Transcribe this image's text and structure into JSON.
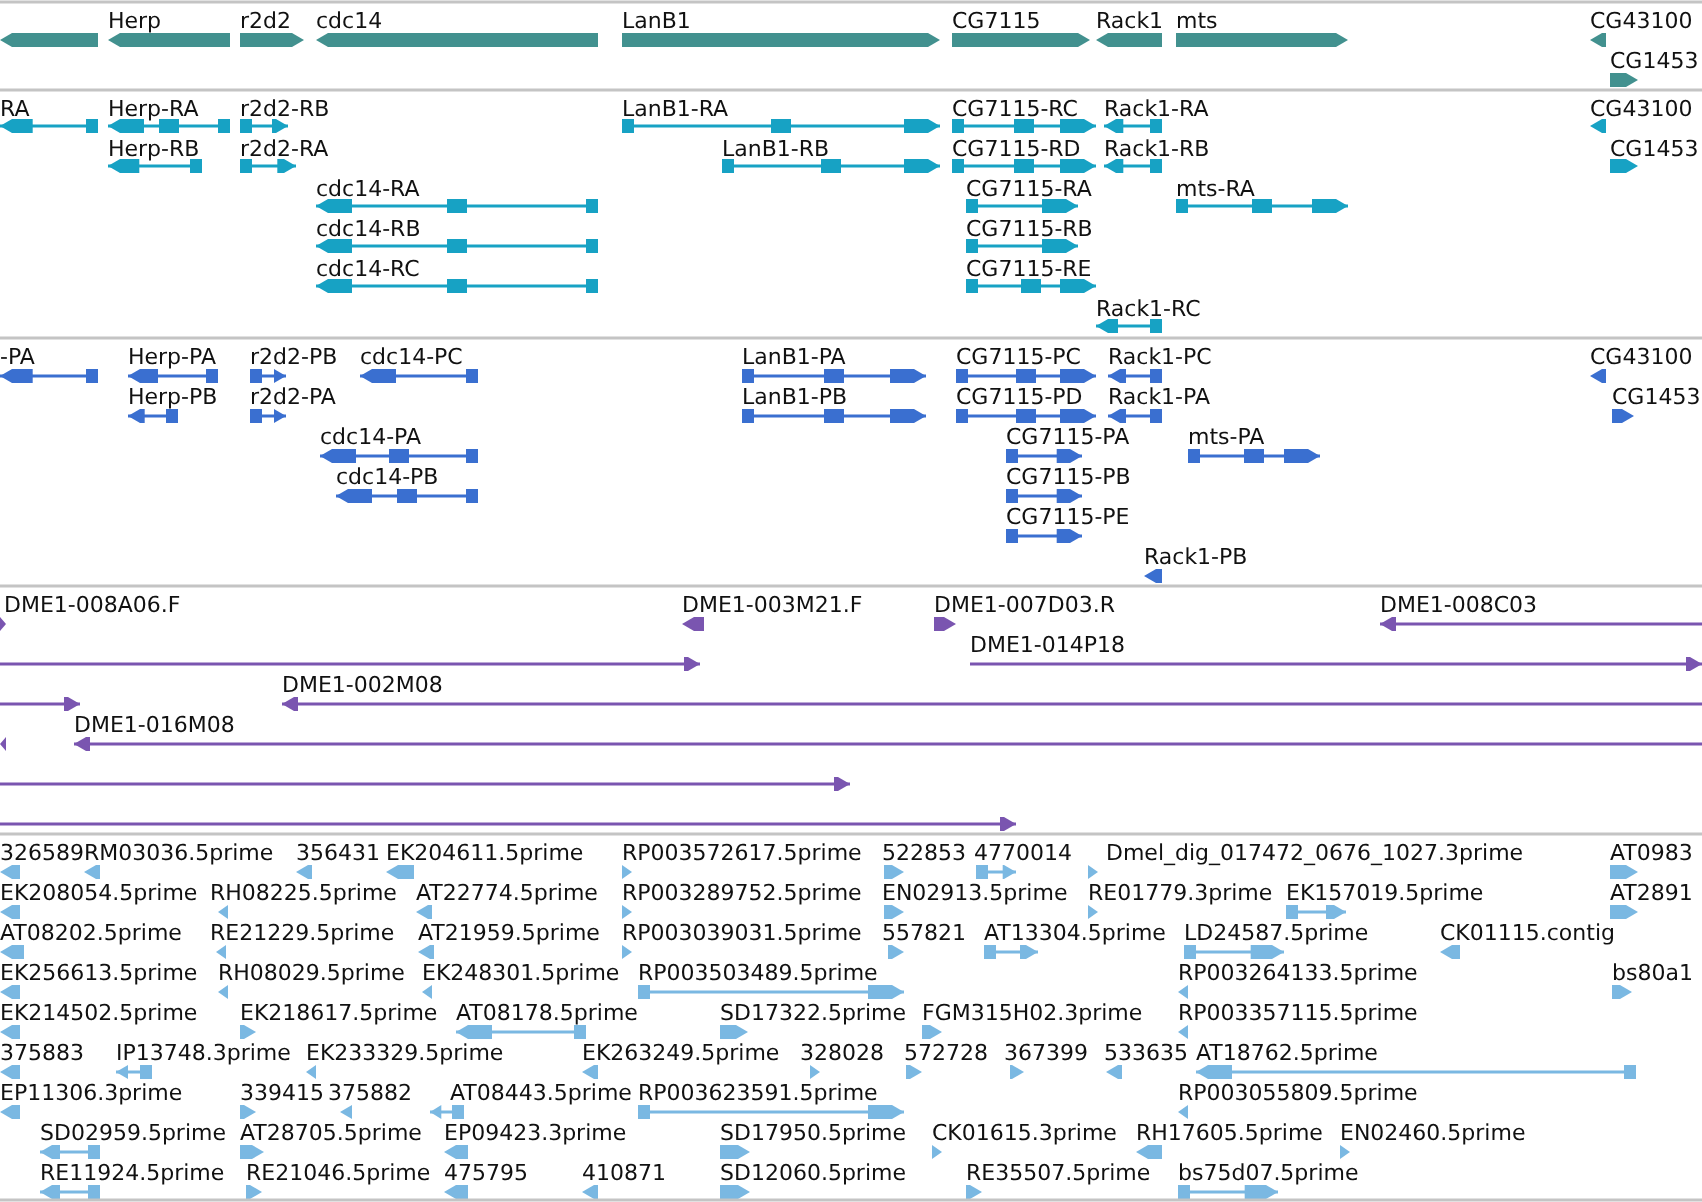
{
  "tracks": [
    {
      "kind": "gene",
      "color": "#42918f",
      "features": [
        {
          "reverse": true
        },
        {
          "label": "Herp",
          "reverse": true
        },
        {
          "label": "r2d2",
          "reverse": false
        },
        {
          "label": "cdc14",
          "reverse": true
        },
        {
          "label": "LanB1",
          "reverse": false
        },
        {
          "label": "CG7115",
          "reverse": false
        },
        {
          "label": "Rack1",
          "reverse": true
        },
        {
          "label": "mts",
          "reverse": false
        },
        {
          "label": "CG43100",
          "reverse": true
        },
        {
          "label": "CG1453",
          "reverse": false
        }
      ]
    },
    {
      "kind": "transcript",
      "color": "#17a2c4",
      "features": [
        {
          "label": "RA",
          "reverse": true
        },
        {
          "label": "Herp-RA",
          "reverse": true
        },
        {
          "label": "r2d2-RB",
          "reverse": false
        },
        {
          "label": "LanB1-RA",
          "reverse": false
        },
        {
          "label": "CG7115-RC",
          "reverse": false
        },
        {
          "label": "Rack1-RA",
          "reverse": true
        },
        {
          "label": "CG43100",
          "reverse": true
        },
        {
          "label": "Herp-RB",
          "reverse": true
        },
        {
          "label": "r2d2-RA",
          "reverse": false
        },
        {
          "label": "LanB1-RB",
          "reverse": false
        },
        {
          "label": "CG7115-RD",
          "reverse": false
        },
        {
          "label": "Rack1-RB",
          "reverse": true
        },
        {
          "label": "CG1453",
          "reverse": false
        },
        {
          "label": "cdc14-RA",
          "reverse": true
        },
        {
          "label": "CG7115-RA",
          "reverse": false
        },
        {
          "label": "mts-RA",
          "reverse": false
        },
        {
          "label": "cdc14-RB",
          "reverse": true
        },
        {
          "label": "CG7115-RB",
          "reverse": false
        },
        {
          "label": "cdc14-RC",
          "reverse": true
        },
        {
          "label": "CG7115-RE",
          "reverse": false
        },
        {
          "label": "Rack1-RC",
          "reverse": true
        }
      ]
    },
    {
      "kind": "protein",
      "color": "#3a6fd0",
      "features": [
        {
          "label": "-PA",
          "reverse": true
        },
        {
          "label": "Herp-PA",
          "reverse": true
        },
        {
          "label": "r2d2-PB",
          "reverse": false
        },
        {
          "label": "cdc14-PC",
          "reverse": true
        },
        {
          "label": "LanB1-PA",
          "reverse": false
        },
        {
          "label": "CG7115-PC",
          "reverse": false
        },
        {
          "label": "Rack1-PC",
          "reverse": true
        },
        {
          "label": "CG43100",
          "reverse": true
        },
        {
          "label": "Herp-PB",
          "reverse": true
        },
        {
          "label": "r2d2-PA",
          "reverse": false
        },
        {
          "label": "LanB1-PB",
          "reverse": false
        },
        {
          "label": "CG7115-PD",
          "reverse": false
        },
        {
          "label": "Rack1-PA",
          "reverse": true
        },
        {
          "label": "CG1453",
          "reverse": false
        },
        {
          "label": "cdc14-PA",
          "reverse": true
        },
        {
          "label": "CG7115-PA",
          "reverse": false
        },
        {
          "label": "mts-PA",
          "reverse": false
        },
        {
          "label": "cdc14-PB",
          "reverse": true
        },
        {
          "label": "CG7115-PB",
          "reverse": false
        },
        {
          "label": "CG7115-PE",
          "reverse": false
        },
        {
          "label": "Rack1-PB",
          "reverse": true
        }
      ]
    },
    {
      "kind": "clone",
      "color": "#7a55b0",
      "features": [
        {
          "label": "DME1-008A06.F",
          "reverse": false
        },
        {
          "label": "DME1-003M21.F",
          "reverse": true
        },
        {
          "label": "DME1-007D03.R",
          "reverse": false
        },
        {
          "label": "DME1-008C03",
          "reverse": true
        },
        {
          "reverse": false
        },
        {
          "label": "DME1-014P18",
          "reverse": false
        },
        {
          "reverse": false
        },
        {
          "label": "DME1-002M08",
          "reverse": true
        },
        {
          "reverse": true
        },
        {
          "label": "DME1-016M08",
          "reverse": true
        },
        {
          "reverse": false
        },
        {
          "reverse": false
        }
      ]
    },
    {
      "kind": "est",
      "color": "#7ab8e2",
      "features": [
        {
          "label": "326589",
          "reverse": true
        },
        {
          "label": "RM03036.5prime",
          "reverse": true
        },
        {
          "label": "356431",
          "reverse": true
        },
        {
          "label": "EK204611.5prime",
          "reverse": true
        },
        {
          "label": "RP003572617.5prime",
          "reverse": false
        },
        {
          "label": "522853",
          "reverse": false
        },
        {
          "label": "4770014",
          "reverse": false
        },
        {
          "label": "Dmel_dig_017472_0676_1027.3prime",
          "reverse": false
        },
        {
          "label": "AT0983",
          "reverse": false
        },
        {
          "label": "EK208054.5prime",
          "reverse": true
        },
        {
          "label": "RH08225.5prime",
          "reverse": true
        },
        {
          "label": "AT22774.5prime",
          "reverse": true
        },
        {
          "label": "RP003289752.5prime",
          "reverse": false
        },
        {
          "label": "EN02913.5prime",
          "reverse": false
        },
        {
          "label": "RE01779.3prime",
          "reverse": false
        },
        {
          "label": "EK157019.5prime",
          "reverse": false
        },
        {
          "label": "AT2891",
          "reverse": false
        },
        {
          "label": "AT08202.5prime",
          "reverse": true
        },
        {
          "label": "RE21229.5prime",
          "reverse": true
        },
        {
          "label": "AT21959.5prime",
          "reverse": true
        },
        {
          "label": "RP003039031.5prime",
          "reverse": false
        },
        {
          "label": "557821",
          "reverse": false
        },
        {
          "label": "AT13304.5prime",
          "reverse": false
        },
        {
          "label": "LD24587.5prime",
          "reverse": false
        },
        {
          "label": "CK01115.contig",
          "reverse": true
        },
        {
          "label": "EK256613.5prime",
          "reverse": true
        },
        {
          "label": "RH08029.5prime",
          "reverse": true
        },
        {
          "label": "EK248301.5prime",
          "reverse": true
        },
        {
          "label": "RP003503489.5prime",
          "reverse": false
        },
        {
          "label": "RP003264133.5prime",
          "reverse": true
        },
        {
          "label": "bs80a1",
          "reverse": false
        },
        {
          "label": "EK214502.5prime",
          "reverse": true
        },
        {
          "label": "EK218617.5prime",
          "reverse": false
        },
        {
          "label": "AT08178.5prime",
          "reverse": true
        },
        {
          "label": "SD17322.5prime",
          "reverse": false
        },
        {
          "label": "FGM315H02.3prime",
          "reverse": false
        },
        {
          "label": "RP003357115.5prime",
          "reverse": true
        },
        {
          "label": "375883",
          "reverse": true
        },
        {
          "label": "IP13748.3prime",
          "reverse": true
        },
        {
          "label": "EK233329.5prime",
          "reverse": true
        },
        {
          "label": "EK263249.5prime",
          "reverse": true
        },
        {
          "label": "328028",
          "reverse": false
        },
        {
          "label": "572728",
          "reverse": false
        },
        {
          "label": "367399",
          "reverse": false
        },
        {
          "label": "533635",
          "reverse": true
        },
        {
          "label": "AT18762.5prime",
          "reverse": true
        },
        {
          "label": "EP11306.3prime",
          "reverse": true
        },
        {
          "label": "339415",
          "reverse": false
        },
        {
          "label": "375882",
          "reverse": true
        },
        {
          "label": "AT08443.5prime",
          "reverse": true
        },
        {
          "label": "RP003623591.5prime",
          "reverse": false
        },
        {
          "label": "RP003055809.5prime",
          "reverse": true
        },
        {
          "label": "SD02959.5prime",
          "reverse": true
        },
        {
          "label": "AT28705.5prime",
          "reverse": false
        },
        {
          "label": "EP09423.3prime",
          "reverse": true
        },
        {
          "label": "SD17950.5prime",
          "reverse": false
        },
        {
          "label": "CK01615.3prime",
          "reverse": false
        },
        {
          "label": "RH17605.5prime",
          "reverse": true
        },
        {
          "label": "EN02460.5prime",
          "reverse": false
        },
        {
          "label": "RE11924.5prime",
          "reverse": true
        },
        {
          "label": "RE21046.5prime",
          "reverse": false
        },
        {
          "label": "475795",
          "reverse": true
        },
        {
          "label": "410871",
          "reverse": true
        },
        {
          "label": "SD12060.5prime",
          "reverse": false
        },
        {
          "label": "RE35507.5prime",
          "reverse": false
        },
        {
          "label": "bs75d07.5prime",
          "reverse": false
        }
      ]
    }
  ]
}
